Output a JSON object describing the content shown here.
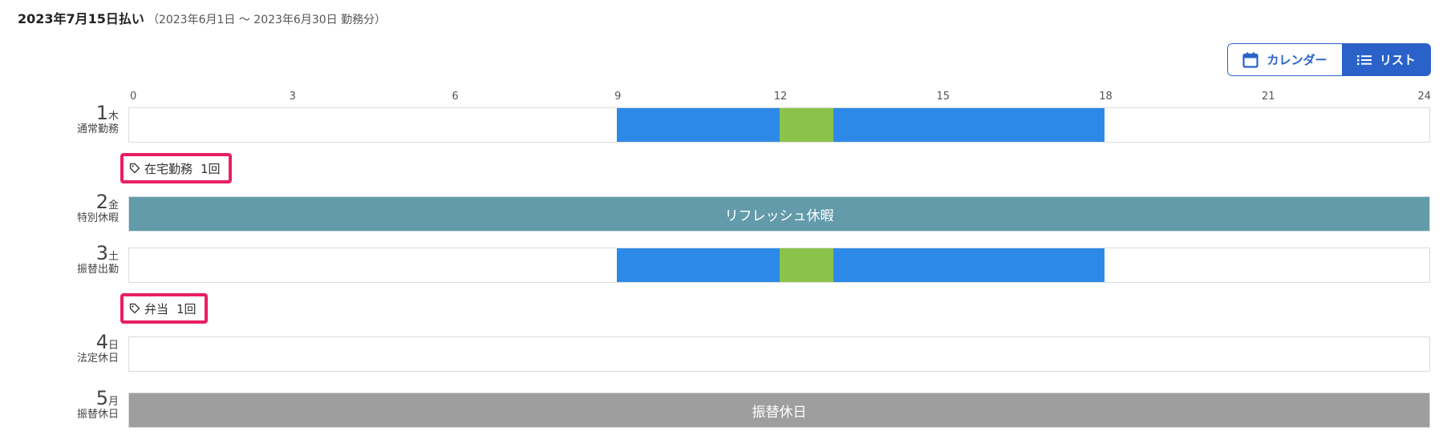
{
  "header": {
    "pay_date": "2023年7月15日払い",
    "period": "（2023年6月1日 ～ 2023年6月30日 勤務分）"
  },
  "view_toggle": {
    "calendar_label": "カレンダー",
    "list_label": "リスト",
    "selected": "リスト"
  },
  "axis": {
    "min_hour": 0,
    "max_hour": 24,
    "ticks": [
      "0",
      "3",
      "6",
      "9",
      "12",
      "15",
      "18",
      "21",
      "24"
    ]
  },
  "colors": {
    "work": "#2d89e8",
    "break": "#8bc34a",
    "special_leave": "#639baa",
    "substitute_holiday": "#9e9e9e",
    "tag_highlight": "#e91e63",
    "toggle_accent": "#2a62c9"
  },
  "days": [
    {
      "day": "1",
      "weekday": "木",
      "type": "通常勤務",
      "segments": [
        {
          "kind": "work",
          "start": 9,
          "end": 12
        },
        {
          "kind": "break",
          "start": 12,
          "end": 13
        },
        {
          "kind": "work",
          "start": 13,
          "end": 18
        }
      ],
      "tag": {
        "icon": "tag-icon",
        "label": "在宅勤務",
        "count": "1回"
      }
    },
    {
      "day": "2",
      "weekday": "金",
      "type": "特別休暇",
      "full_bar": "リフレッシュ休暇"
    },
    {
      "day": "3",
      "weekday": "土",
      "type": "振替出勤",
      "segments": [
        {
          "kind": "work",
          "start": 9,
          "end": 12
        },
        {
          "kind": "break",
          "start": 12,
          "end": 13
        },
        {
          "kind": "work",
          "start": 13,
          "end": 18
        }
      ],
      "tag": {
        "icon": "tag-icon",
        "label": "弁当",
        "count": "1回"
      }
    },
    {
      "day": "4",
      "weekday": "日",
      "type": "法定休日",
      "segments": []
    },
    {
      "day": "5",
      "weekday": "月",
      "type": "振替休日",
      "full_bar": "振替休日"
    }
  ]
}
